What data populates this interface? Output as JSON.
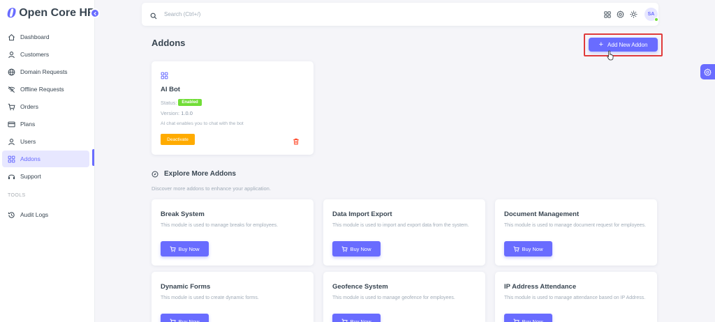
{
  "brand": {
    "logo_letter": "0",
    "name": "Open Core HR"
  },
  "sidebar": {
    "items": [
      {
        "label": "Dashboard",
        "icon": "home-icon"
      },
      {
        "label": "Customers",
        "icon": "user-icon"
      },
      {
        "label": "Domain Requests",
        "icon": "globe-icon"
      },
      {
        "label": "Offline Requests",
        "icon": "wifi-off-icon"
      },
      {
        "label": "Orders",
        "icon": "cart-icon"
      },
      {
        "label": "Plans",
        "icon": "credit-card-icon"
      },
      {
        "label": "Users",
        "icon": "user-icon"
      },
      {
        "label": "Addons",
        "icon": "grid-icon",
        "active": true
      },
      {
        "label": "Support",
        "icon": "headset-icon"
      }
    ],
    "section_header": "TOOLS",
    "tools_items": [
      {
        "label": "Audit Logs",
        "icon": "history-icon"
      }
    ]
  },
  "topbar": {
    "search_placeholder": "Search (Ctrl+/)",
    "avatar_initials": "SA",
    "icons": [
      "apps-icon",
      "settings-icon",
      "theme-sun-icon"
    ]
  },
  "page": {
    "title": "Addons",
    "add_button_label": "Add New Addon"
  },
  "installed_addon": {
    "name": "AI Bot",
    "status_label": "Status:",
    "status_value": "Enabled",
    "version_label": "Version:",
    "version_value": "1.0.0",
    "description": "AI chat enables you to chat with the bot",
    "deactivate_label": "Deactivate"
  },
  "explore": {
    "title": "Explore More Addons",
    "subtitle": "Discover more addons to enhance your application.",
    "buy_label": "Buy Now",
    "modules": [
      {
        "title": "Break System",
        "desc": "This module is used to manage breaks for employees."
      },
      {
        "title": "Data Import Export",
        "desc": "This module is used to import and export data from the system."
      },
      {
        "title": "Document Management",
        "desc": "This module is used to manage document request for employees."
      },
      {
        "title": "Dynamic Forms",
        "desc": "This module is used to create dynamic forms."
      },
      {
        "title": "Geofence System",
        "desc": "This module is used to manage geofence for employees."
      },
      {
        "title": "IP Address Attendance",
        "desc": "This module is used to manage attendance based on IP Address."
      }
    ]
  },
  "colors": {
    "primary": "#696cff",
    "success": "#71dd37",
    "warning": "#ffab00",
    "danger": "#ff3e1d",
    "highlight": "#e03b3b"
  }
}
